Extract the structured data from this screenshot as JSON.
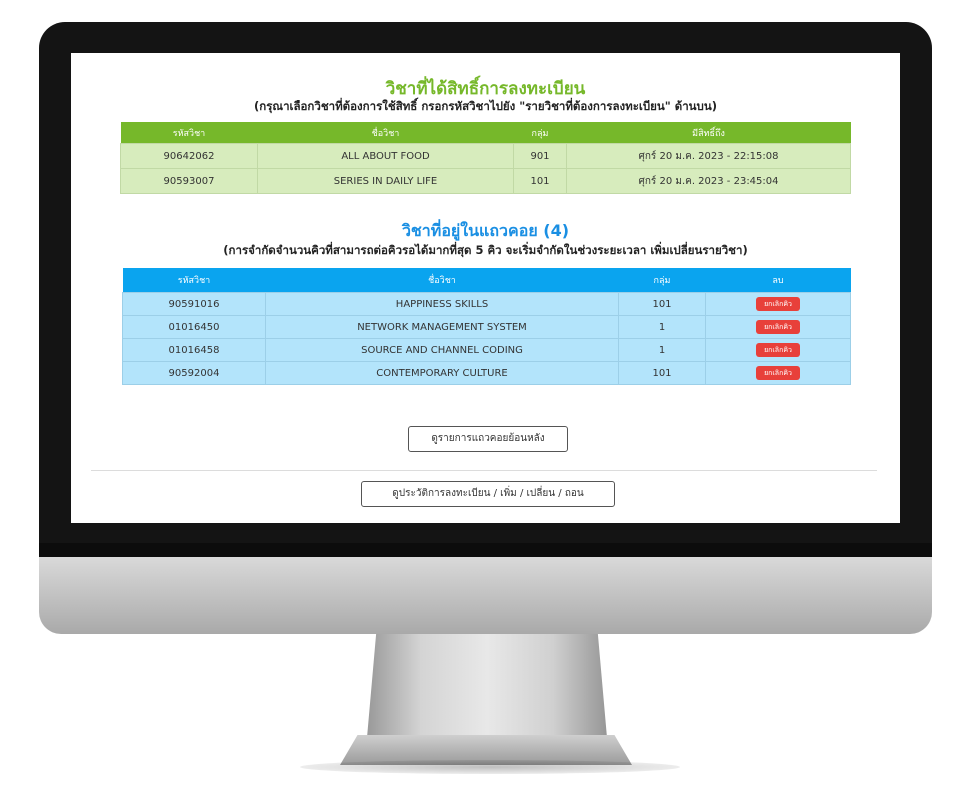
{
  "registered": {
    "title": "วิชาที่ได้สิทธิ์การลงทะเบียน",
    "subtitle": "(กรุณาเลือกวิชาที่ต้องการใช้สิทธิ์ กรอกรหัสวิชาไปยัง \"รายวิชาที่ต้องการลงทะเบียน\" ด้านบน)",
    "columns": [
      "รหัสวิชา",
      "ชื่อวิชา",
      "กลุ่ม",
      "มีสิทธิ์ถึง"
    ],
    "rows": [
      {
        "code": "90642062",
        "name": "ALL ABOUT FOOD",
        "group": "901",
        "until": "ศุกร์ 20 ม.ค. 2023 - 22:15:08"
      },
      {
        "code": "90593007",
        "name": "SERIES IN DAILY LIFE",
        "group": "101",
        "until": "ศุกร์ 20 ม.ค. 2023 - 23:45:04"
      }
    ]
  },
  "queue": {
    "title": "วิชาที่อยู่ในแถวคอย (4)",
    "subtitle": "(การจำกัดจำนวนคิวที่สามารถต่อคิวรอได้มากที่สุด 5 คิว จะเริ่มจำกัดในช่วงระยะเวลา เพิ่มเปลี่ยนรายวิชา)",
    "columns": [
      "รหัสวิชา",
      "ชื่อวิชา",
      "กลุ่ม",
      "ลบ"
    ],
    "cancel_label": "ยกเลิกคิว",
    "rows": [
      {
        "code": "90591016",
        "name": "HAPPINESS SKILLS",
        "group": "101"
      },
      {
        "code": "01016450",
        "name": "NETWORK MANAGEMENT SYSTEM",
        "group": "1"
      },
      {
        "code": "01016458",
        "name": "SOURCE AND CHANNEL CODING",
        "group": "1"
      },
      {
        "code": "90592004",
        "name": "CONTEMPORARY CULTURE",
        "group": "101"
      }
    ]
  },
  "buttons": {
    "history_queue": "ดูรายการแถวคอยย้อนหลัง",
    "registration_history": "ดูประวัติการลงทะเบียน / เพิ่ม / เปลี่ยน / ถอน"
  },
  "colors": {
    "green_header": "#76b82a",
    "green_row": "#d7ecbd",
    "blue_header": "#0aa4ef",
    "blue_row": "#b3e4fb",
    "cancel_button": "#e8403a"
  }
}
